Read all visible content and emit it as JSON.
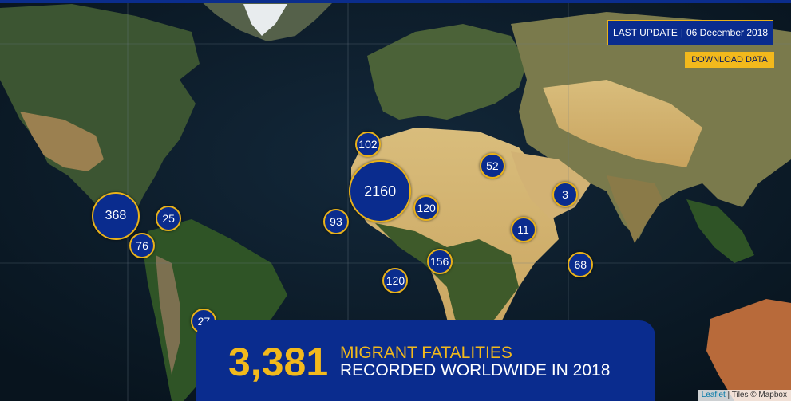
{
  "colors": {
    "marker_fill": "#0a2c8e",
    "marker_border": "#e9b21a",
    "accent_yellow": "#f2b91c",
    "panel_blue": "#0a2c8e"
  },
  "header": {
    "last_update_label": "LAST UPDATE",
    "last_update_date": "06 December 2018",
    "download_label": "DOWNLOAD DATA"
  },
  "summary": {
    "total": "3,381",
    "line1": "MIGRANT FATALITIES",
    "line2": "RECORDED WORLDWIDE IN 2018"
  },
  "attribution": {
    "leaflet": "Leaflet",
    "tiles": "Tiles © Mapbox"
  },
  "markers": [
    {
      "id": "north-europe",
      "count": "102",
      "lat": 53.5,
      "lon": 10.5
    },
    {
      "id": "mediterranean",
      "count": "2160",
      "lat": 36.0,
      "lon": 16.0
    },
    {
      "id": "central-asia",
      "count": "52",
      "lat": 45.5,
      "lon": 67.0
    },
    {
      "id": "east-asia",
      "count": "3",
      "lat": 35.0,
      "lon": 100.0
    },
    {
      "id": "middle-east",
      "count": "120",
      "lat": 30.0,
      "lon": 37.0
    },
    {
      "id": "north-africa",
      "count": "93",
      "lat": 25.0,
      "lon": -4.0
    },
    {
      "id": "south-asia",
      "count": "11",
      "lat": 22.0,
      "lon": 81.0
    },
    {
      "id": "horn-of-africa",
      "count": "156",
      "lat": 10.0,
      "lon": 43.0
    },
    {
      "id": "southeast-asia",
      "count": "68",
      "lat": 9.0,
      "lon": 107.0
    },
    {
      "id": "central-africa",
      "count": "120",
      "lat": 3.0,
      "lon": 23.0
    },
    {
      "id": "us-mexico-border",
      "count": "368",
      "lat": 27.0,
      "lon": -104.0
    },
    {
      "id": "caribbean",
      "count": "25",
      "lat": 26.0,
      "lon": -80.0
    },
    {
      "id": "central-america",
      "count": "76",
      "lat": 16.0,
      "lon": -92.0
    },
    {
      "id": "south-america",
      "count": "27",
      "lat": -12.0,
      "lon": -64.0
    }
  ]
}
